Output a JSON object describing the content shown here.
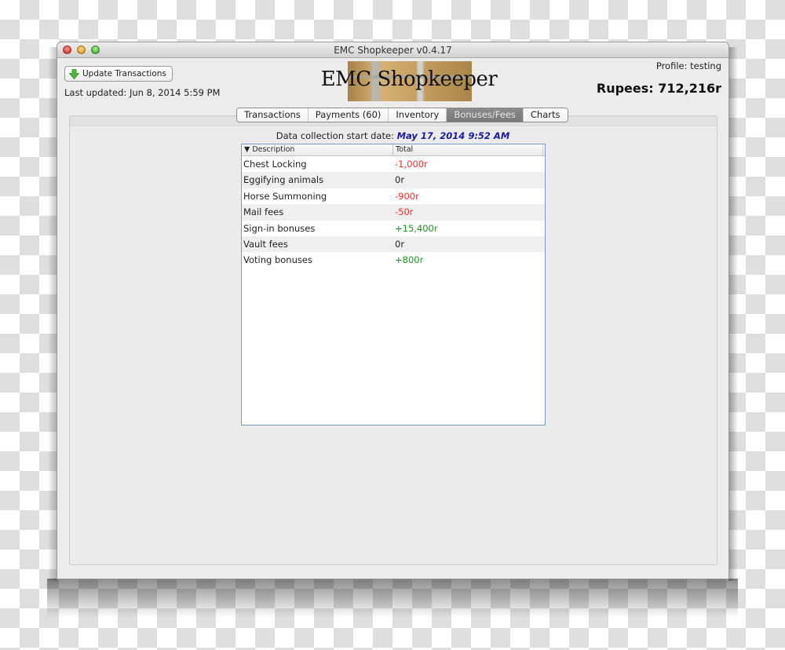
{
  "window": {
    "title": "EMC Shopkeeper v0.4.17"
  },
  "header": {
    "update_button_label": "Update Transactions",
    "last_updated": "Last updated: Jun 8, 2014 5:59 PM",
    "logo_text": "EMC Shopkeeper",
    "profile": "Profile: testing",
    "rupees": "Rupees: 712,216r"
  },
  "tabs": [
    {
      "label": "Transactions",
      "active": false
    },
    {
      "label": "Payments (60)",
      "active": false
    },
    {
      "label": "Inventory",
      "active": false
    },
    {
      "label": "Bonuses/Fees",
      "active": true
    },
    {
      "label": "Charts",
      "active": false
    }
  ],
  "bonuses": {
    "start_date_label": "Data collection start date:",
    "start_date_value": "May 17, 2014 9:52 AM",
    "columns": {
      "description": "▼ Description",
      "total": "Total"
    },
    "rows": [
      {
        "description": "Chest Locking",
        "total": "-1,000r",
        "sign": "neg"
      },
      {
        "description": "Eggifying animals",
        "total": "0r",
        "sign": "zero"
      },
      {
        "description": "Horse Summoning",
        "total": "-900r",
        "sign": "neg"
      },
      {
        "description": "Mail fees",
        "total": "-50r",
        "sign": "neg"
      },
      {
        "description": "Sign-in bonuses",
        "total": "+15,400r",
        "sign": "pos"
      },
      {
        "description": "Vault fees",
        "total": "0r",
        "sign": "zero"
      },
      {
        "description": "Voting bonuses",
        "total": "+800r",
        "sign": "pos"
      }
    ]
  },
  "colors": {
    "negative": "#ff2a2a",
    "positive": "#1a9a1a",
    "date_accent": "#1a1aa6"
  }
}
